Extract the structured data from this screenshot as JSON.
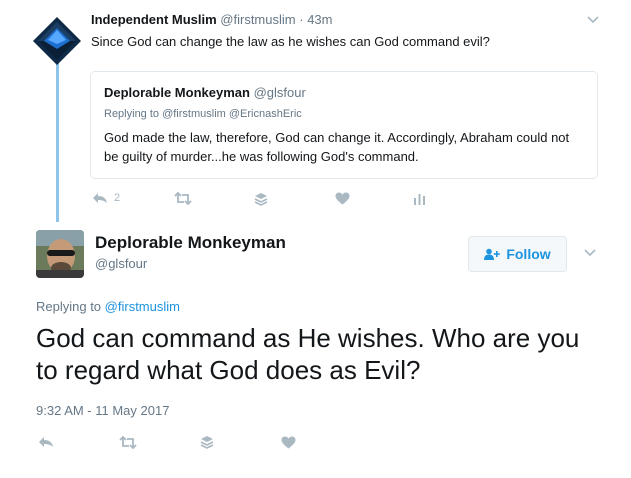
{
  "parent_tweet": {
    "author_name": "Independent Muslim",
    "handle": "@firstmuslim",
    "separator": "·",
    "time": "43m",
    "text": "Since God can change the law as he wishes can God command evil?",
    "quoted_tweet": {
      "author_name": "Deplorable Monkeyman",
      "handle": "@glsfour",
      "replying_to": "Replying to @firstmuslim @EricnashEric",
      "text": "God made the law, therefore, God can change it. Accordingly, Abraham could not be guilty of murder...he was following God's command."
    },
    "actions": {
      "reply_count": "2"
    }
  },
  "main_tweet": {
    "author_name": "Deplorable Monkeyman",
    "handle": "@glsfour",
    "follow_label": "Follow",
    "replying_prefix": "Replying to",
    "replying_user": "@firstmuslim",
    "text": "God can command as He wishes. Who are you to regard what God does as Evil?",
    "timestamp": "9:32 AM - 11 May 2017"
  },
  "colors": {
    "accent": "#1c94e0",
    "muted": "#657786",
    "icon": "#aab8c2",
    "thread_line": "#8ec5e8",
    "border": "#e1e8ed"
  },
  "icons": [
    "reply-icon",
    "retweet-icon",
    "stack-icon",
    "like-icon",
    "analytics-icon",
    "chevron-down-icon",
    "follow-person-icon"
  ]
}
